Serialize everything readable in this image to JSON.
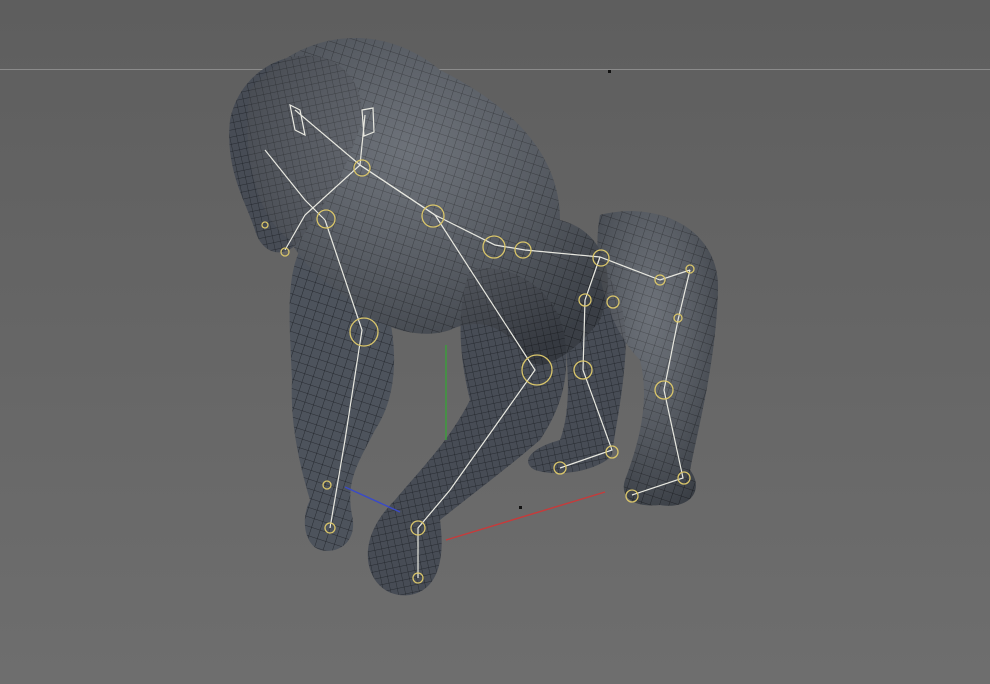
{
  "viewport": {
    "background": "#656565",
    "mesh_fill": "#4a4f57",
    "wire_color": "#1c1f24",
    "bone_color": "#e8e8e0",
    "joint_color": "#d9c56a",
    "axes": {
      "x_color": "#c83a3a",
      "y_color": "#3aa03a",
      "z_color": "#3a4ac8"
    }
  },
  "scene": {
    "object": "gorilla-character-mesh",
    "display_mode": "shaded-wireframe",
    "skeleton_visible": true
  }
}
